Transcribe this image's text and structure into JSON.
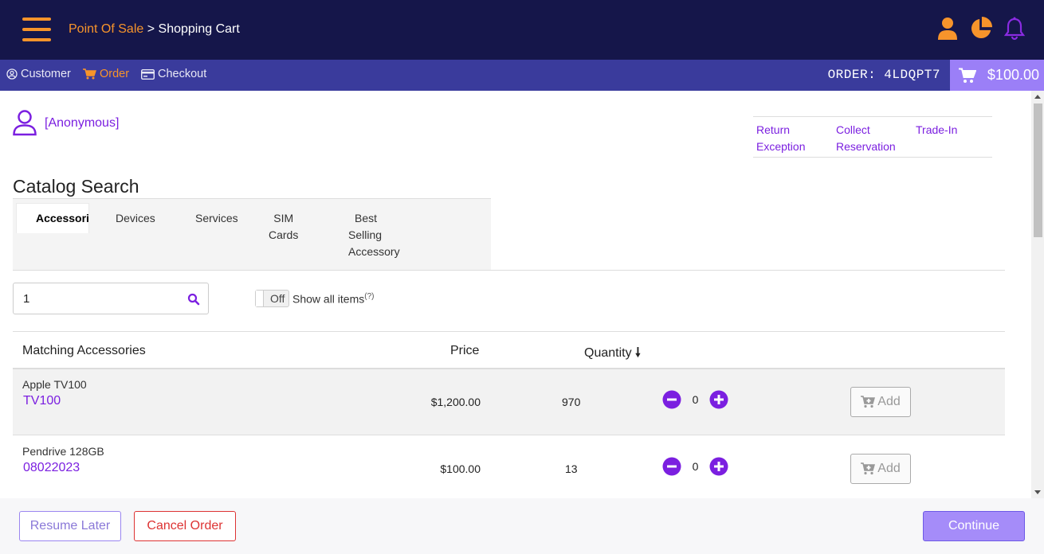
{
  "header": {
    "breadcrumb_root": "Point Of Sale",
    "breadcrumb_sep": ">",
    "breadcrumb_current": "Shopping Cart",
    "icons": [
      "menu-icon",
      "user-icon",
      "pie-chart-icon",
      "bell-icon"
    ],
    "accent_color": "#f7942b",
    "bg_color": "#15164a"
  },
  "subnav": {
    "items": [
      {
        "label": "Customer",
        "icon": "user-circle-icon"
      },
      {
        "label": "Order",
        "icon": "cart-icon"
      },
      {
        "label": "Checkout",
        "icon": "credit-card-icon"
      }
    ],
    "order_id": "ORDER: 4LDQPT7",
    "cart_total": "$100.00"
  },
  "customer": {
    "name": "[Anonymous]"
  },
  "quick_links": [
    {
      "line1": "Return",
      "line2": "Exception"
    },
    {
      "line1": "Collect",
      "line2": "Reservation"
    },
    {
      "line1": "Trade-In",
      "line2": ""
    }
  ],
  "catalog": {
    "title": "Catalog Search",
    "tabs": [
      {
        "label": "Accessories"
      },
      {
        "label": "Devices"
      },
      {
        "label": "Services"
      },
      {
        "line1": "SIM",
        "line2": "Cards"
      },
      {
        "line1": "Best",
        "line2": "Selling",
        "line3": "Accessory"
      }
    ],
    "search_value": "1",
    "toggle_label": "Off",
    "show_all_label": "Show all items",
    "help_mark": "?"
  },
  "table": {
    "headers": {
      "name": "Matching Accessories",
      "price": "Price",
      "quantity": "Quantity",
      "sort_indicator": "🠗"
    },
    "rows": [
      {
        "description": "Apple TV100",
        "sku": "TV100",
        "price": "$1,200.00",
        "quantity": "970",
        "count": "0",
        "add_label": "Add"
      },
      {
        "description": "Pendrive 128GB",
        "sku": "08022023",
        "price": "$100.00",
        "quantity": "13",
        "count": "0",
        "add_label": "Add"
      }
    ]
  },
  "footer": {
    "resume_label": "Resume Later",
    "cancel_label": "Cancel Order",
    "continue_label": "Continue"
  }
}
